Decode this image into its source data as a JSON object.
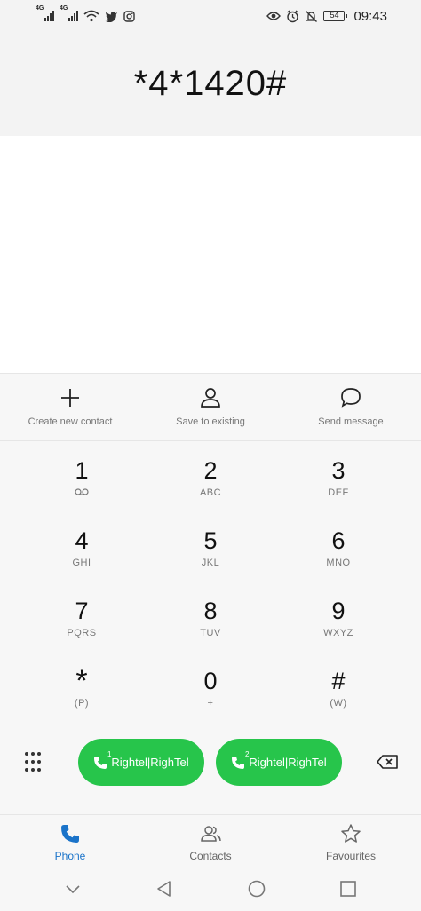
{
  "status_bar": {
    "sim1_label": "4G",
    "sim2_label": "4G",
    "battery": "54",
    "time": "09:43",
    "icons": [
      "signal-icon",
      "signal-icon",
      "wifi-icon",
      "twitter-icon",
      "instagram-icon",
      "eye-icon",
      "alarm-icon",
      "mute-icon",
      "battery-icon"
    ]
  },
  "dialer": {
    "number": "*4*1420#"
  },
  "actions": [
    {
      "label": "Create new contact",
      "icon": "plus-icon"
    },
    {
      "label": "Save to existing",
      "icon": "person-icon"
    },
    {
      "label": "Send message",
      "icon": "message-icon"
    }
  ],
  "keypad": [
    {
      "digit": "1",
      "letters": ""
    },
    {
      "digit": "2",
      "letters": "ABC"
    },
    {
      "digit": "3",
      "letters": "DEF"
    },
    {
      "digit": "4",
      "letters": "GHI"
    },
    {
      "digit": "5",
      "letters": "JKL"
    },
    {
      "digit": "6",
      "letters": "MNO"
    },
    {
      "digit": "7",
      "letters": "PQRS"
    },
    {
      "digit": "8",
      "letters": "TUV"
    },
    {
      "digit": "9",
      "letters": "WXYZ"
    },
    {
      "digit": "*",
      "letters": "(P)"
    },
    {
      "digit": "0",
      "letters": "+"
    },
    {
      "digit": "#",
      "letters": "(W)"
    }
  ],
  "call_buttons": [
    {
      "sim": "1",
      "label": "Rightel|RighTel"
    },
    {
      "sim": "2",
      "label": "Rightel|RighTel"
    }
  ],
  "tabs": [
    {
      "label": "Phone",
      "icon": "phone-icon",
      "active": true
    },
    {
      "label": "Contacts",
      "icon": "contacts-icon",
      "active": false
    },
    {
      "label": "Favourites",
      "icon": "star-icon",
      "active": false
    }
  ],
  "colors": {
    "accent": "#1a73c9",
    "call_green": "#27c54b"
  }
}
